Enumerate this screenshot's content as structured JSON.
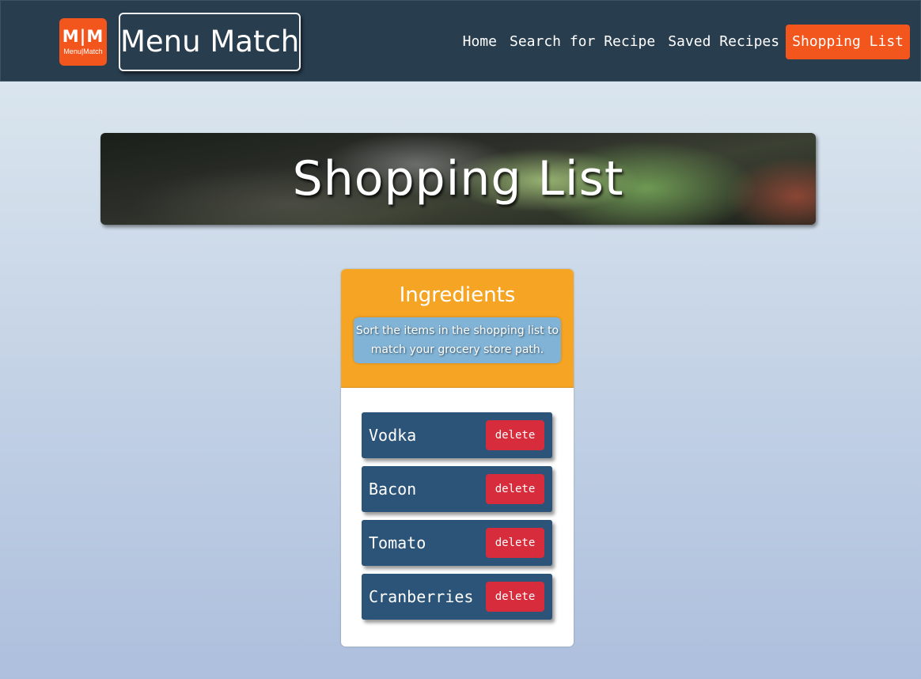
{
  "header": {
    "logo": {
      "mark": "M|M",
      "subtext": "Menu|Match"
    },
    "brand": "Menu Match",
    "nav": [
      {
        "label": "Home",
        "active": false
      },
      {
        "label": "Search for Recipe",
        "active": false
      },
      {
        "label": "Saved Recipes",
        "active": false
      },
      {
        "label": "Shopping List",
        "active": true
      }
    ]
  },
  "hero": {
    "title": "Shopping List"
  },
  "ingredients": {
    "title": "Ingredients",
    "hint": "Sort the items in the shopping list to match your grocery store path.",
    "items": [
      {
        "name": "Vodka",
        "action": "delete"
      },
      {
        "name": "Bacon",
        "action": "delete"
      },
      {
        "name": "Tomato",
        "action": "delete"
      },
      {
        "name": "Cranberries",
        "action": "delete"
      }
    ]
  },
  "colors": {
    "navbar": "#283d4e",
    "accent": "#f2561d",
    "card_header": "#f5a523",
    "hint_bg": "#80b3d6",
    "item_bg": "#2b5478",
    "delete_btn": "#d72c3b"
  }
}
